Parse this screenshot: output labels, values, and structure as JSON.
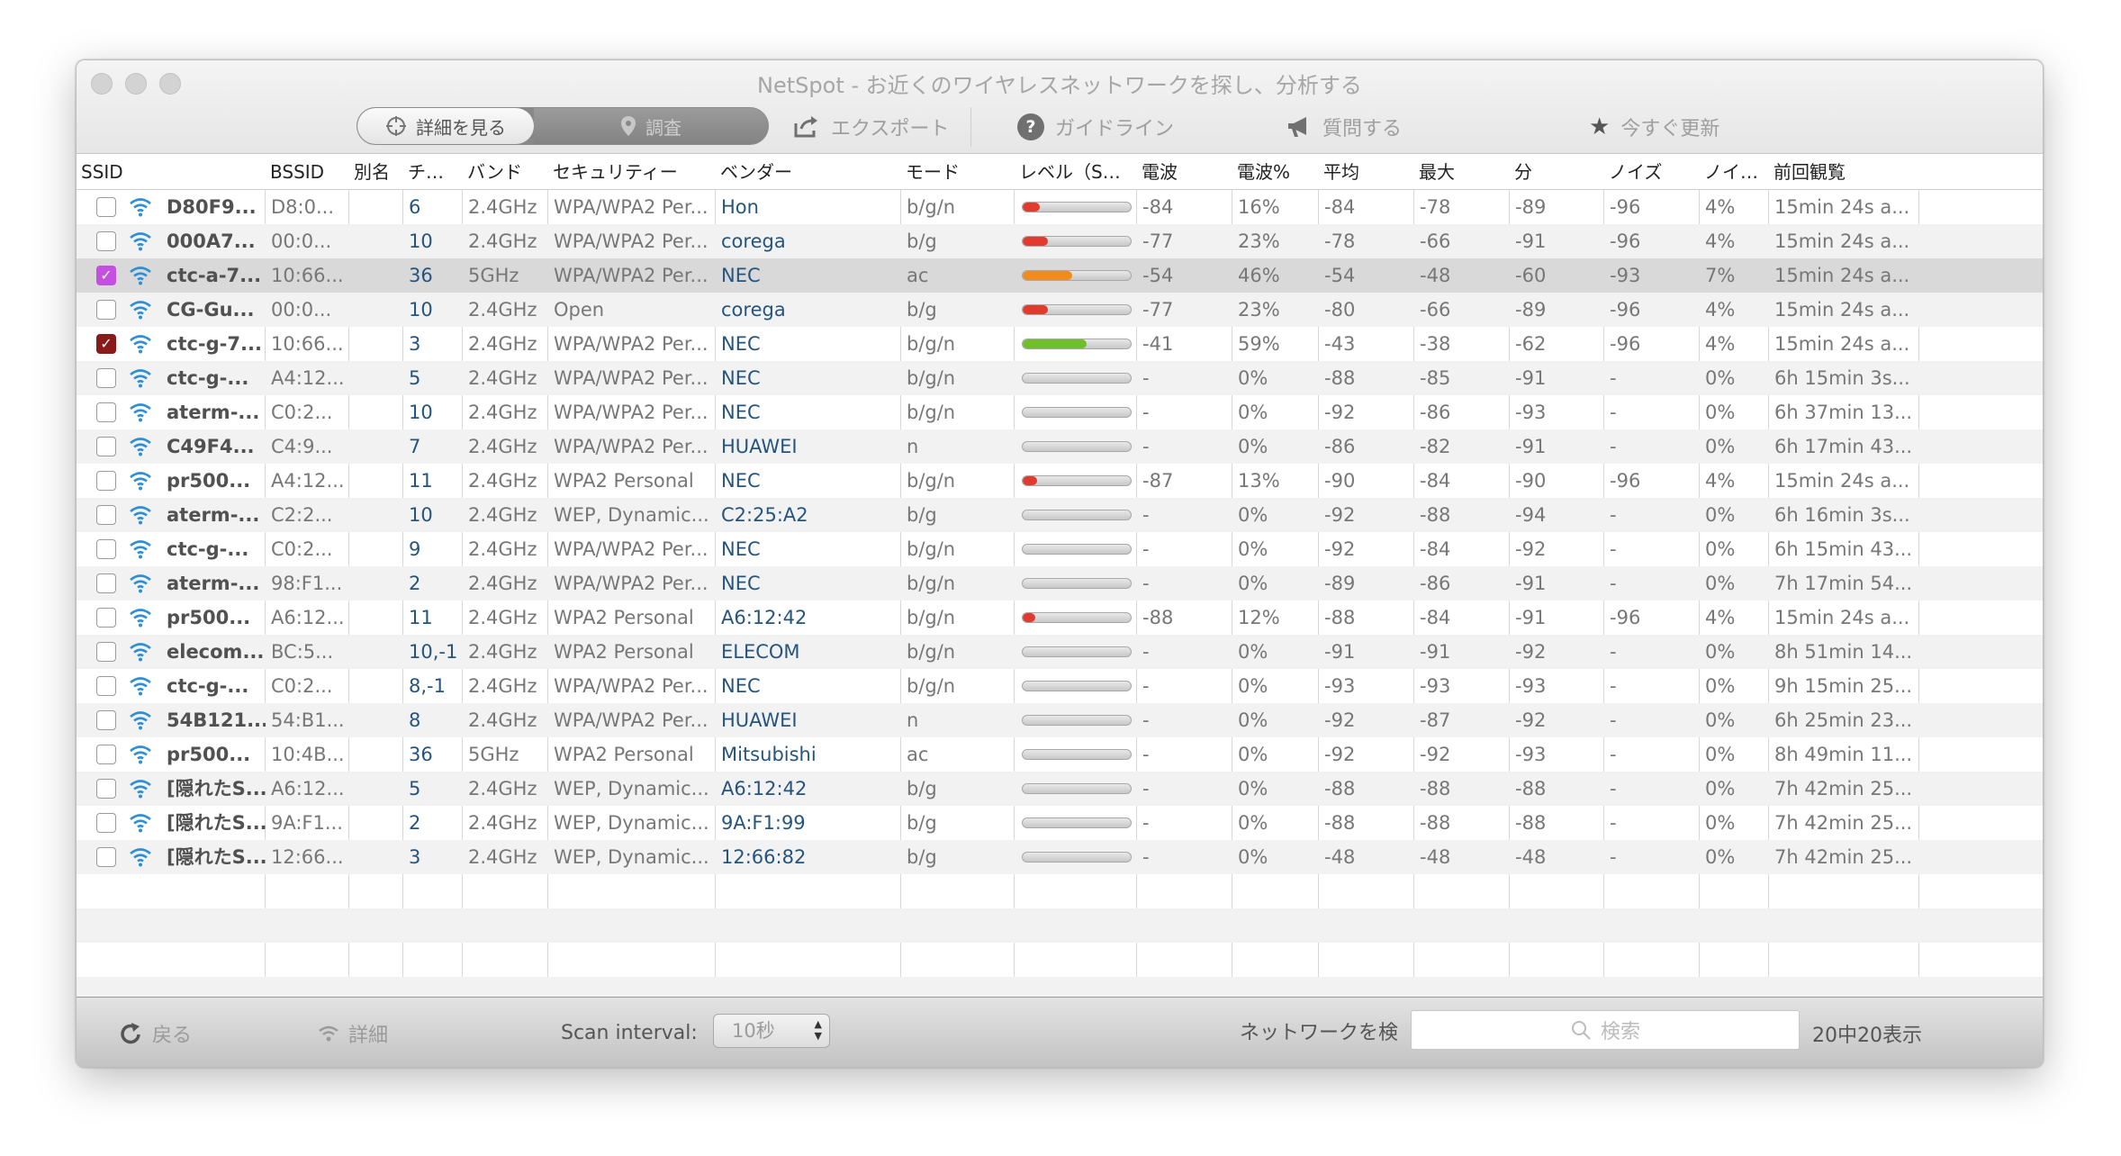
{
  "window": {
    "title": "NetSpot - お近くのワイヤレスネットワークを探し、分析する"
  },
  "toolbar": {
    "modes": [
      {
        "label": "詳細を見る",
        "icon": "crosshair-icon",
        "active": true
      },
      {
        "label": "調査",
        "icon": "map-pin-icon",
        "active": false
      }
    ],
    "export_label": "エクスポート",
    "guidelines_label": "ガイドライン",
    "ask_label": "質問する",
    "update_label": "今すぐ更新"
  },
  "table": {
    "headers": [
      "SSID",
      "BSSID",
      "別名",
      "チ…",
      "バンド",
      "セキュリティー",
      "ベンダー",
      "モード",
      "レベル（S…",
      "電波",
      "電波%",
      "平均",
      "最大",
      "分",
      "ノイズ",
      "ノイ…",
      "前回観覧"
    ],
    "rows": [
      {
        "checked": false,
        "check_color": "",
        "ssid": "D80F9...",
        "bssid": "D8:0...",
        "alias": "",
        "channel": "6",
        "band": "2.4GHz",
        "security": "WPA/WPA2 Per...",
        "vendor": "Hon",
        "mode": "b/g/n",
        "level": 0.16,
        "signal": "-84",
        "signal_pct": "16%",
        "avg": "-84",
        "max": "-78",
        "min": "-89",
        "noise": "-96",
        "noise_pct": "4%",
        "last_seen": "15min 24s a..."
      },
      {
        "checked": false,
        "check_color": "",
        "ssid": "000A7...",
        "bssid": "00:0...",
        "alias": "",
        "channel": "10",
        "band": "2.4GHz",
        "security": "WPA/WPA2 Per...",
        "vendor": "corega",
        "mode": "b/g",
        "level": 0.23,
        "signal": "-77",
        "signal_pct": "23%",
        "avg": "-78",
        "max": "-66",
        "min": "-91",
        "noise": "-96",
        "noise_pct": "4%",
        "last_seen": "15min 24s a..."
      },
      {
        "checked": true,
        "check_color": "#c44fe0",
        "ssid": "ctc-a-7...",
        "bssid": "10:66...",
        "alias": "",
        "channel": "36",
        "band": "5GHz",
        "security": "WPA/WPA2 Per...",
        "vendor": "NEC",
        "mode": "ac",
        "level": 0.46,
        "signal": "-54",
        "signal_pct": "46%",
        "avg": "-54",
        "max": "-48",
        "min": "-60",
        "noise": "-93",
        "noise_pct": "7%",
        "last_seen": "15min 24s a..."
      },
      {
        "checked": false,
        "check_color": "",
        "ssid": "CG-Gu...",
        "bssid": "00:0...",
        "alias": "",
        "channel": "10",
        "band": "2.4GHz",
        "security": "Open",
        "vendor": "corega",
        "mode": "b/g",
        "level": 0.23,
        "signal": "-77",
        "signal_pct": "23%",
        "avg": "-80",
        "max": "-66",
        "min": "-89",
        "noise": "-96",
        "noise_pct": "4%",
        "last_seen": "15min 24s a..."
      },
      {
        "checked": true,
        "check_color": "#8a1a1a",
        "ssid": "ctc-g-7...",
        "bssid": "10:66...",
        "alias": "",
        "channel": "3",
        "band": "2.4GHz",
        "security": "WPA/WPA2 Per...",
        "vendor": "NEC",
        "mode": "b/g/n",
        "level": 0.59,
        "signal": "-41",
        "signal_pct": "59%",
        "avg": "-43",
        "max": "-38",
        "min": "-62",
        "noise": "-96",
        "noise_pct": "4%",
        "last_seen": "15min 24s a..."
      },
      {
        "checked": false,
        "check_color": "",
        "ssid": "ctc-g-...",
        "bssid": "A4:12...",
        "alias": "",
        "channel": "5",
        "band": "2.4GHz",
        "security": "WPA/WPA2 Per...",
        "vendor": "NEC",
        "mode": "b/g/n",
        "level": 0,
        "signal": "-",
        "signal_pct": "0%",
        "avg": "-88",
        "max": "-85",
        "min": "-91",
        "noise": "-",
        "noise_pct": "0%",
        "last_seen": "6h 15min 3s..."
      },
      {
        "checked": false,
        "check_color": "",
        "ssid": "aterm-...",
        "bssid": "C0:2...",
        "alias": "",
        "channel": "10",
        "band": "2.4GHz",
        "security": "WPA/WPA2 Per...",
        "vendor": "NEC",
        "mode": "b/g/n",
        "level": 0,
        "signal": "-",
        "signal_pct": "0%",
        "avg": "-92",
        "max": "-86",
        "min": "-93",
        "noise": "-",
        "noise_pct": "0%",
        "last_seen": "6h 37min 13..."
      },
      {
        "checked": false,
        "check_color": "",
        "ssid": "C49F4...",
        "bssid": "C4:9...",
        "alias": "",
        "channel": "7",
        "band": "2.4GHz",
        "security": "WPA/WPA2 Per...",
        "vendor": "HUAWEI",
        "mode": "n",
        "level": 0,
        "signal": "-",
        "signal_pct": "0%",
        "avg": "-86",
        "max": "-82",
        "min": "-91",
        "noise": "-",
        "noise_pct": "0%",
        "last_seen": "6h 17min 43..."
      },
      {
        "checked": false,
        "check_color": "",
        "ssid": "pr500...",
        "bssid": "A4:12...",
        "alias": "",
        "channel": "11",
        "band": "2.4GHz",
        "security": "WPA2 Personal",
        "vendor": "NEC",
        "mode": "b/g/n",
        "level": 0.13,
        "signal": "-87",
        "signal_pct": "13%",
        "avg": "-90",
        "max": "-84",
        "min": "-90",
        "noise": "-96",
        "noise_pct": "4%",
        "last_seen": "15min 24s a..."
      },
      {
        "checked": false,
        "check_color": "",
        "ssid": "aterm-...",
        "bssid": "C2:2...",
        "alias": "",
        "channel": "10",
        "band": "2.4GHz",
        "security": "WEP, Dynamic...",
        "vendor": "C2:25:A2",
        "mode": "b/g",
        "level": 0,
        "signal": "-",
        "signal_pct": "0%",
        "avg": "-92",
        "max": "-88",
        "min": "-94",
        "noise": "-",
        "noise_pct": "0%",
        "last_seen": "6h 16min 3s..."
      },
      {
        "checked": false,
        "check_color": "",
        "ssid": "ctc-g-...",
        "bssid": "C0:2...",
        "alias": "",
        "channel": "9",
        "band": "2.4GHz",
        "security": "WPA/WPA2 Per...",
        "vendor": "NEC",
        "mode": "b/g/n",
        "level": 0,
        "signal": "-",
        "signal_pct": "0%",
        "avg": "-92",
        "max": "-84",
        "min": "-92",
        "noise": "-",
        "noise_pct": "0%",
        "last_seen": "6h 15min 43..."
      },
      {
        "checked": false,
        "check_color": "",
        "ssid": "aterm-...",
        "bssid": "98:F1...",
        "alias": "",
        "channel": "2",
        "band": "2.4GHz",
        "security": "WPA/WPA2 Per...",
        "vendor": "NEC",
        "mode": "b/g/n",
        "level": 0,
        "signal": "-",
        "signal_pct": "0%",
        "avg": "-89",
        "max": "-86",
        "min": "-91",
        "noise": "-",
        "noise_pct": "0%",
        "last_seen": "7h 17min 54..."
      },
      {
        "checked": false,
        "check_color": "",
        "ssid": "pr500...",
        "bssid": "A6:12...",
        "alias": "",
        "channel": "11",
        "band": "2.4GHz",
        "security": "WPA2 Personal",
        "vendor": "A6:12:42",
        "mode": "b/g/n",
        "level": 0.12,
        "signal": "-88",
        "signal_pct": "12%",
        "avg": "-88",
        "max": "-84",
        "min": "-91",
        "noise": "-96",
        "noise_pct": "4%",
        "last_seen": "15min 24s a..."
      },
      {
        "checked": false,
        "check_color": "",
        "ssid": "elecom...",
        "bssid": "BC:5...",
        "alias": "",
        "channel": "10,-1",
        "band": "2.4GHz",
        "security": "WPA2 Personal",
        "vendor": "ELECOM",
        "mode": "b/g/n",
        "level": 0,
        "signal": "-",
        "signal_pct": "0%",
        "avg": "-91",
        "max": "-91",
        "min": "-92",
        "noise": "-",
        "noise_pct": "0%",
        "last_seen": "8h 51min 14..."
      },
      {
        "checked": false,
        "check_color": "",
        "ssid": "ctc-g-...",
        "bssid": "C0:2...",
        "alias": "",
        "channel": "8,-1",
        "band": "2.4GHz",
        "security": "WPA/WPA2 Per...",
        "vendor": "NEC",
        "mode": "b/g/n",
        "level": 0,
        "signal": "-",
        "signal_pct": "0%",
        "avg": "-93",
        "max": "-93",
        "min": "-93",
        "noise": "-",
        "noise_pct": "0%",
        "last_seen": "9h 15min 25..."
      },
      {
        "checked": false,
        "check_color": "",
        "ssid": "54B121...",
        "bssid": "54:B1...",
        "alias": "",
        "channel": "8",
        "band": "2.4GHz",
        "security": "WPA/WPA2 Per...",
        "vendor": "HUAWEI",
        "mode": "n",
        "level": 0,
        "signal": "-",
        "signal_pct": "0%",
        "avg": "-92",
        "max": "-87",
        "min": "-92",
        "noise": "-",
        "noise_pct": "0%",
        "last_seen": "6h 25min 23..."
      },
      {
        "checked": false,
        "check_color": "",
        "ssid": "pr500...",
        "bssid": "10:4B...",
        "alias": "",
        "channel": "36",
        "band": "5GHz",
        "security": "WPA2 Personal",
        "vendor": "Mitsubishi",
        "mode": "ac",
        "level": 0,
        "signal": "-",
        "signal_pct": "0%",
        "avg": "-92",
        "max": "-92",
        "min": "-93",
        "noise": "-",
        "noise_pct": "0%",
        "last_seen": "8h 49min 11..."
      },
      {
        "checked": false,
        "check_color": "",
        "ssid": "[隠れたS...",
        "bssid": "A6:12...",
        "alias": "",
        "channel": "5",
        "band": "2.4GHz",
        "security": "WEP, Dynamic...",
        "vendor": "A6:12:42",
        "mode": "b/g",
        "level": 0,
        "signal": "-",
        "signal_pct": "0%",
        "avg": "-88",
        "max": "-88",
        "min": "-88",
        "noise": "-",
        "noise_pct": "0%",
        "last_seen": "7h 42min 25..."
      },
      {
        "checked": false,
        "check_color": "",
        "ssid": "[隠れたS...",
        "bssid": "9A:F1...",
        "alias": "",
        "channel": "2",
        "band": "2.4GHz",
        "security": "WEP, Dynamic...",
        "vendor": "9A:F1:99",
        "mode": "b/g",
        "level": 0,
        "signal": "-",
        "signal_pct": "0%",
        "avg": "-88",
        "max": "-88",
        "min": "-88",
        "noise": "-",
        "noise_pct": "0%",
        "last_seen": "7h 42min 25..."
      },
      {
        "checked": false,
        "check_color": "",
        "ssid": "[隠れたS...",
        "bssid": "12:66...",
        "alias": "",
        "channel": "3",
        "band": "2.4GHz",
        "security": "WEP, Dynamic...",
        "vendor": "12:66:82",
        "mode": "b/g",
        "level": 0,
        "signal": "-",
        "signal_pct": "0%",
        "avg": "-48",
        "max": "-48",
        "min": "-48",
        "noise": "-",
        "noise_pct": "0%",
        "last_seen": "7h 42min 25..."
      }
    ]
  },
  "colors": {
    "level_red": "#e03b2e",
    "level_orange": "#f08c1e",
    "level_green": "#6fbf2a",
    "wifi_blue": "#2d8fd6",
    "wifi_orange": "#f08c1e"
  },
  "bottom": {
    "back_label": "戻る",
    "details_label": "詳細",
    "scan_interval_label": "Scan interval:",
    "scan_interval_value": "10秒",
    "search_label": "ネットワークを検",
    "search_placeholder": "検索",
    "count_label": "20中20表示"
  }
}
